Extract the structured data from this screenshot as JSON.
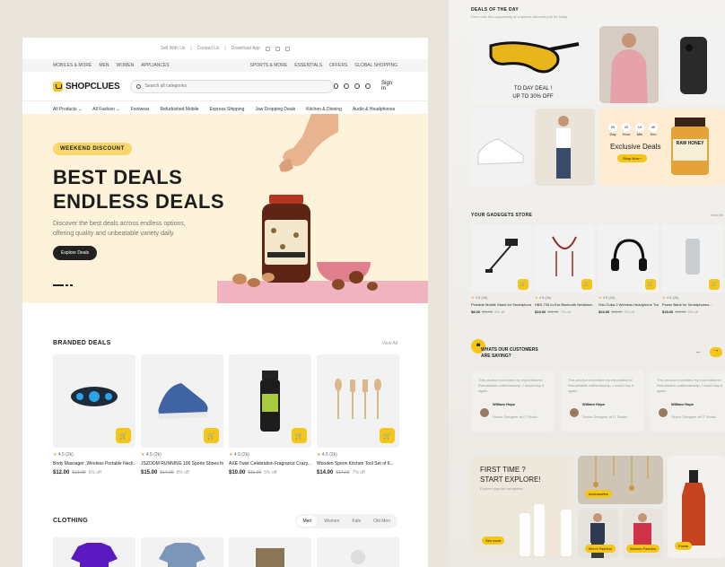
{
  "left": {
    "util_bar": {
      "sell": "Sell With Us",
      "contact": "Contact Us",
      "download": "Download App"
    },
    "catbar": {
      "left": [
        "MOBILES & MORE",
        "MEN",
        "WOMEN",
        "APPLIANCES"
      ],
      "right": [
        "SPORTS & MORE",
        "ESSENTIALS",
        "OFFERS",
        "GLOBAL SHOPPING"
      ]
    },
    "logo": "SHOPCLUES",
    "search_placeholder": "Search all categories",
    "signin": "Sign In",
    "menu": [
      "All Products",
      "All Fashion",
      "Footwear",
      "Refurbished Mobile",
      "Express Shipping",
      "Jaw Dropping Deals",
      "Kitchen & Dinning",
      "Audio & Headphones"
    ],
    "hero": {
      "badge": "WEEKEND DISCOUNT",
      "title_1": "BEST DEALS",
      "title_2": "ENDLESS DEALS",
      "sub": "Discover the best deals across endless options, offering quality and unbeatable variety daily.",
      "cta": "Explore Deals",
      "jar_label": "ERDNUSSMUS"
    },
    "branded": {
      "title": "BRANDED DEALS",
      "view_all": "View All",
      "items": [
        {
          "rating": "4.5",
          "count": "(2k)",
          "name": "Body Massager ,Wireless Portable Neck...",
          "price": "$12.00",
          "old": "$13.00",
          "off": "6% off"
        },
        {
          "rating": "4.5",
          "count": "(2k)",
          "name": "JSZOOM RUNNING 106 Sports Shoes for...",
          "price": "$15.00",
          "old": "$17.00",
          "off": "8% off"
        },
        {
          "rating": "4.5",
          "count": "(2k)",
          "name": "AXE Twist Celebration Fragrance Crazy...",
          "price": "$10.00",
          "old": "$11.00",
          "off": "5% off"
        },
        {
          "rating": "4.5",
          "count": "(2k)",
          "name": "Wooden Spoon Kitchen Tool Set of 6...",
          "price": "$14.00",
          "old": "$17.00",
          "off": "7% off"
        }
      ]
    },
    "clothing": {
      "title": "CLOTHING",
      "tabs": [
        "Men",
        "Women",
        "Kids",
        "Old Men"
      ]
    }
  },
  "right": {
    "deals_title": "DEALS OF THE DAY",
    "deals_sub": "Dont miss this opportunity at a special discount just for today",
    "today_deal": "TO DAY DEAL !",
    "upto": "UP TO 30% OFF",
    "countdown": [
      {
        "n": "00",
        "l": "Day"
      },
      {
        "n": "20",
        "l": "Hour"
      },
      {
        "n": "10",
        "l": "Min"
      },
      {
        "n": "40",
        "l": "Sec"
      }
    ],
    "exclusive": "Exclusive Deals",
    "shop_now": "Shop Now",
    "honey": "RAW HONEY",
    "gadgets_title": "YOUR GADEGETS STORE",
    "gadgets_view": "View All",
    "gadgets": [
      {
        "rating": "4.5",
        "count": "(2k)",
        "name": "Portable Mobile Stand for Smartphones...",
        "price": "$8.00",
        "old": "$11.00",
        "off": "3% off"
      },
      {
        "rating": "4.5",
        "count": "(2k)",
        "name": "HBS-730 In-Ear Bluetooth Necklace...",
        "price": "$19.00",
        "old": "$21.00",
        "off": "7% off"
      },
      {
        "rating": "4.5",
        "count": "(2k)",
        "name": "Odo Cuba 2 Wireless Headphone Trav...",
        "price": "$24.00",
        "old": "$28.00",
        "off": "5% off"
      },
      {
        "rating": "4.5",
        "count": "(2k)",
        "name": "Power Bank for Smartphones...",
        "price": "$15.00",
        "old": "$18.00",
        "off": "5% off"
      }
    ],
    "customers_title_1": "WHATS OUR CUSTOMERS",
    "customers_title_2": "ARE SAYING?",
    "testimonials": [
      {
        "text": "This product exceeded my expectations! Remarkable craftsmanship, I would buy it again.",
        "name": "William Hope",
        "role": "Senior Designer at IT Studio"
      },
      {
        "text": "This product exceeded my expectations! Remarkable craftsmanship, I would buy it again.",
        "name": "William Hope",
        "role": "Senior Designer at IT Studio"
      },
      {
        "text": "This product exceeded my expectations! Remarkable craftsmanship, I would buy it again.",
        "name": "William Hope",
        "role": "Senior Designer at IT Studio"
      }
    ],
    "explore_1": "FIRST TIME ?",
    "explore_2": "START EXPLORE!",
    "explore_sub": "Explore popular categories",
    "see_more": "See more",
    "pills": {
      "accessories": "Accessories",
      "mens": "Men's Fashion",
      "womens": "Women Fashion",
      "foods": "Foods"
    }
  },
  "colors": {
    "accent": "#f5c518",
    "hero_bg": "#fdf3da",
    "pedestal": "#f0b3bf",
    "dark": "#1c1c1c"
  }
}
